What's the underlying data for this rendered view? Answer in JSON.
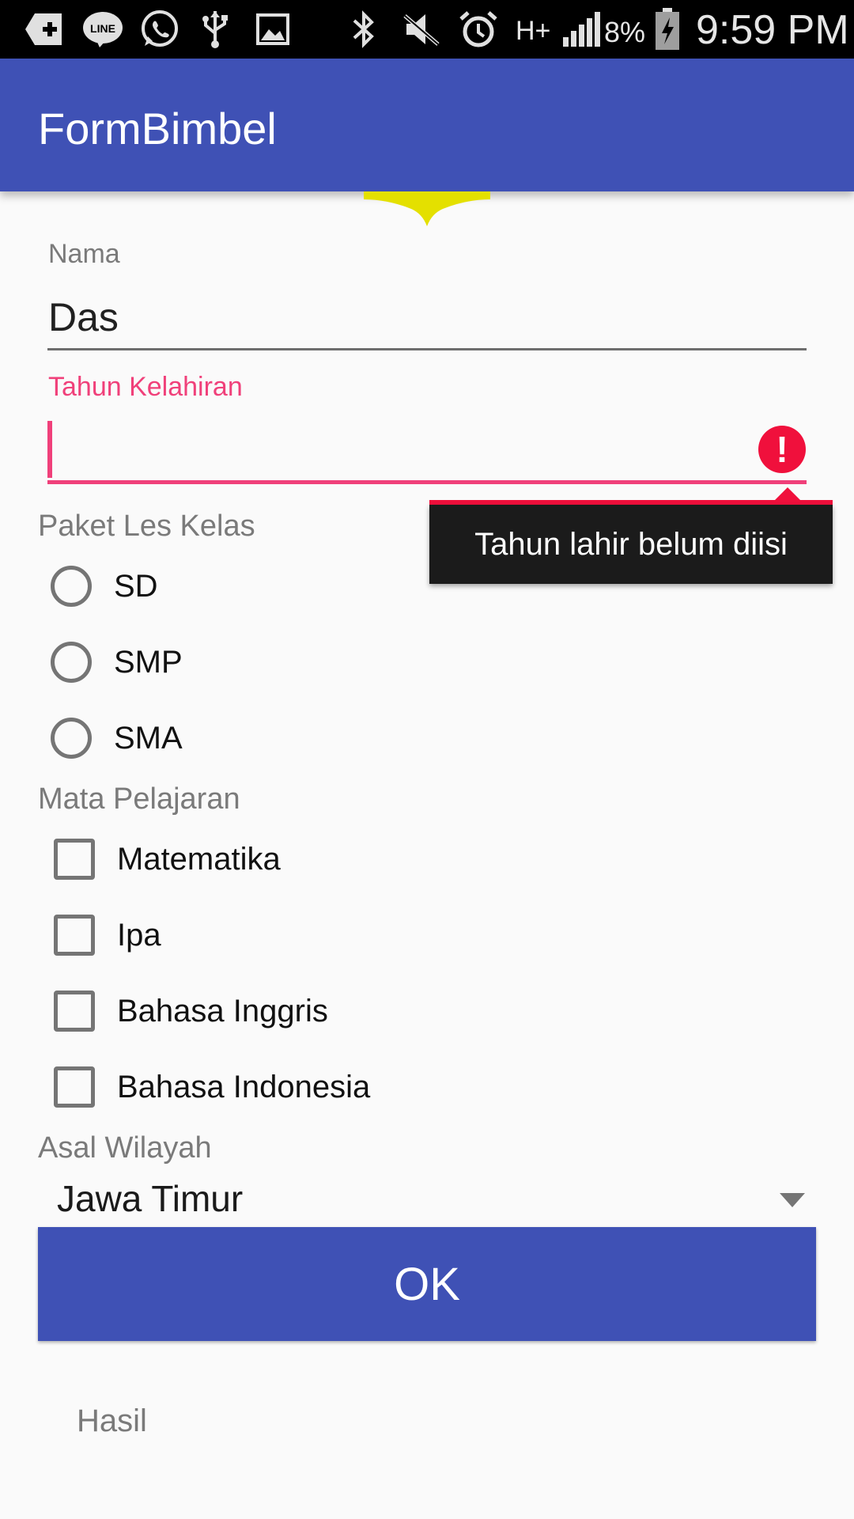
{
  "status_bar": {
    "battery": "8%",
    "time": "9:59 PM",
    "network": "H+",
    "icons": [
      "add-icon",
      "line-app-icon",
      "whatsapp-icon",
      "usb-icon",
      "image-icon",
      "bluetooth-icon",
      "mute-icon",
      "alarm-icon",
      "signal-icon",
      "battery-charging-icon"
    ]
  },
  "app_bar": {
    "title": "FormBimbel"
  },
  "form": {
    "name_label": "Nama",
    "name_value": "Das",
    "year_label": "Tahun Kelahiran",
    "year_value": "",
    "year_error": "Tahun lahir belum diisi",
    "package": {
      "heading": "Paket Les Kelas",
      "options": [
        {
          "label": "SD",
          "selected": false
        },
        {
          "label": "SMP",
          "selected": false
        },
        {
          "label": "SMA",
          "selected": false
        }
      ]
    },
    "subjects": {
      "heading": "Mata Pelajaran",
      "options": [
        {
          "label": "Matematika",
          "checked": false
        },
        {
          "label": "Ipa",
          "checked": false
        },
        {
          "label": "Bahasa Inggris",
          "checked": false
        },
        {
          "label": "Bahasa Indonesia",
          "checked": false
        }
      ]
    },
    "region": {
      "heading": "Asal Wilayah",
      "selected": "Jawa Timur"
    },
    "ok_label": "OK",
    "result_label": "Hasil"
  },
  "colors": {
    "primary": "#3f51b5",
    "accent_error": "#f0407a",
    "error_icon": "#f0103c",
    "overscroll_glow": "#e8e400"
  }
}
